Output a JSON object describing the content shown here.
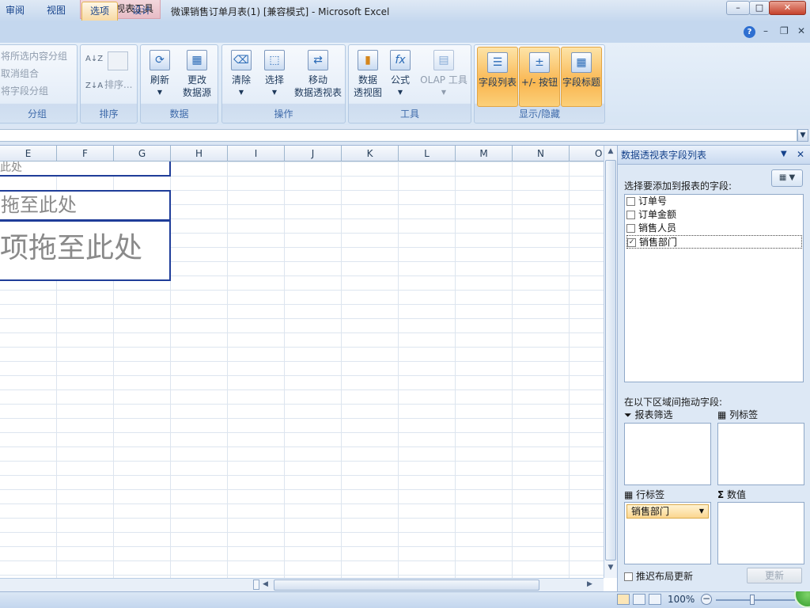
{
  "title": {
    "context_tab": "数据透视表工具",
    "window": "微课销售订单月表(1)  [兼容模式] - Microsoft Excel",
    "minimize": "–",
    "maximize": "□",
    "close": "✕"
  },
  "tabs": [
    {
      "label": "审阅"
    },
    {
      "label": "视图"
    },
    {
      "label": "选项"
    },
    {
      "label": "设计"
    }
  ],
  "ribbon": {
    "group": {
      "items": [
        "将所选内容分组",
        "取消组合",
        "将字段分组"
      ],
      "label": "分组"
    },
    "sort": {
      "az": "A↓Z",
      "za": "Z↓A",
      "custom": "排序...",
      "label": "排序"
    },
    "data": {
      "refresh": "刷新",
      "change_source_1": "更改",
      "change_source_2": "数据源",
      "label": "数据"
    },
    "actions": {
      "clear": "清除",
      "select": "选择",
      "move_1": "移动",
      "move_2": "数据透视表",
      "label": "操作"
    },
    "tools": {
      "chart_1": "数据",
      "chart_2": "透视图",
      "formula": "公式",
      "olap": "OLAP 工具",
      "label": "工具"
    },
    "show": {
      "field_list": "字段列表",
      "buttons": "+/- 按钮",
      "headers": "字段标题",
      "label": "显示/隐藏"
    }
  },
  "columns": [
    "E",
    "F",
    "G",
    "H",
    "I",
    "J",
    "K",
    "L",
    "M",
    "N",
    "O"
  ],
  "pivot_placeholders": [
    "此处",
    "拖至此处",
    "项拖至此处"
  ],
  "panel": {
    "title": "数据透视表字段列表",
    "choose_label": "选择要添加到报表的字段:",
    "fields": [
      {
        "name": "订单号",
        "checked": false
      },
      {
        "name": "订单金额",
        "checked": false
      },
      {
        "name": "销售人员",
        "checked": false
      },
      {
        "name": "销售部门",
        "checked": true
      }
    ],
    "drag_label": "在以下区域间拖动字段:",
    "zones": {
      "filter": "报表筛选",
      "columns": "列标签",
      "rows": "行标签",
      "values": "数值"
    },
    "row_field": "销售部门",
    "defer_label": "推迟布局更新",
    "update_button": "更新"
  },
  "status": {
    "zoom": "100%"
  },
  "colors": {
    "accent": "#f9b650",
    "ribbon": "#d7e5f4",
    "grid": "#dde5ef",
    "pivot_border": "#1f3d99"
  },
  "icons": [
    "refresh-icon",
    "change-source-icon",
    "clear-icon",
    "select-icon",
    "move-pivot-icon",
    "pivot-chart-icon",
    "formula-icon",
    "olap-icon",
    "field-list-icon",
    "buttons-icon",
    "field-headers-icon",
    "help-icon",
    "filter-icon",
    "column-labels-icon",
    "row-labels-icon",
    "sigma-icon",
    "layout-view-icon",
    "zoom-out-icon"
  ]
}
